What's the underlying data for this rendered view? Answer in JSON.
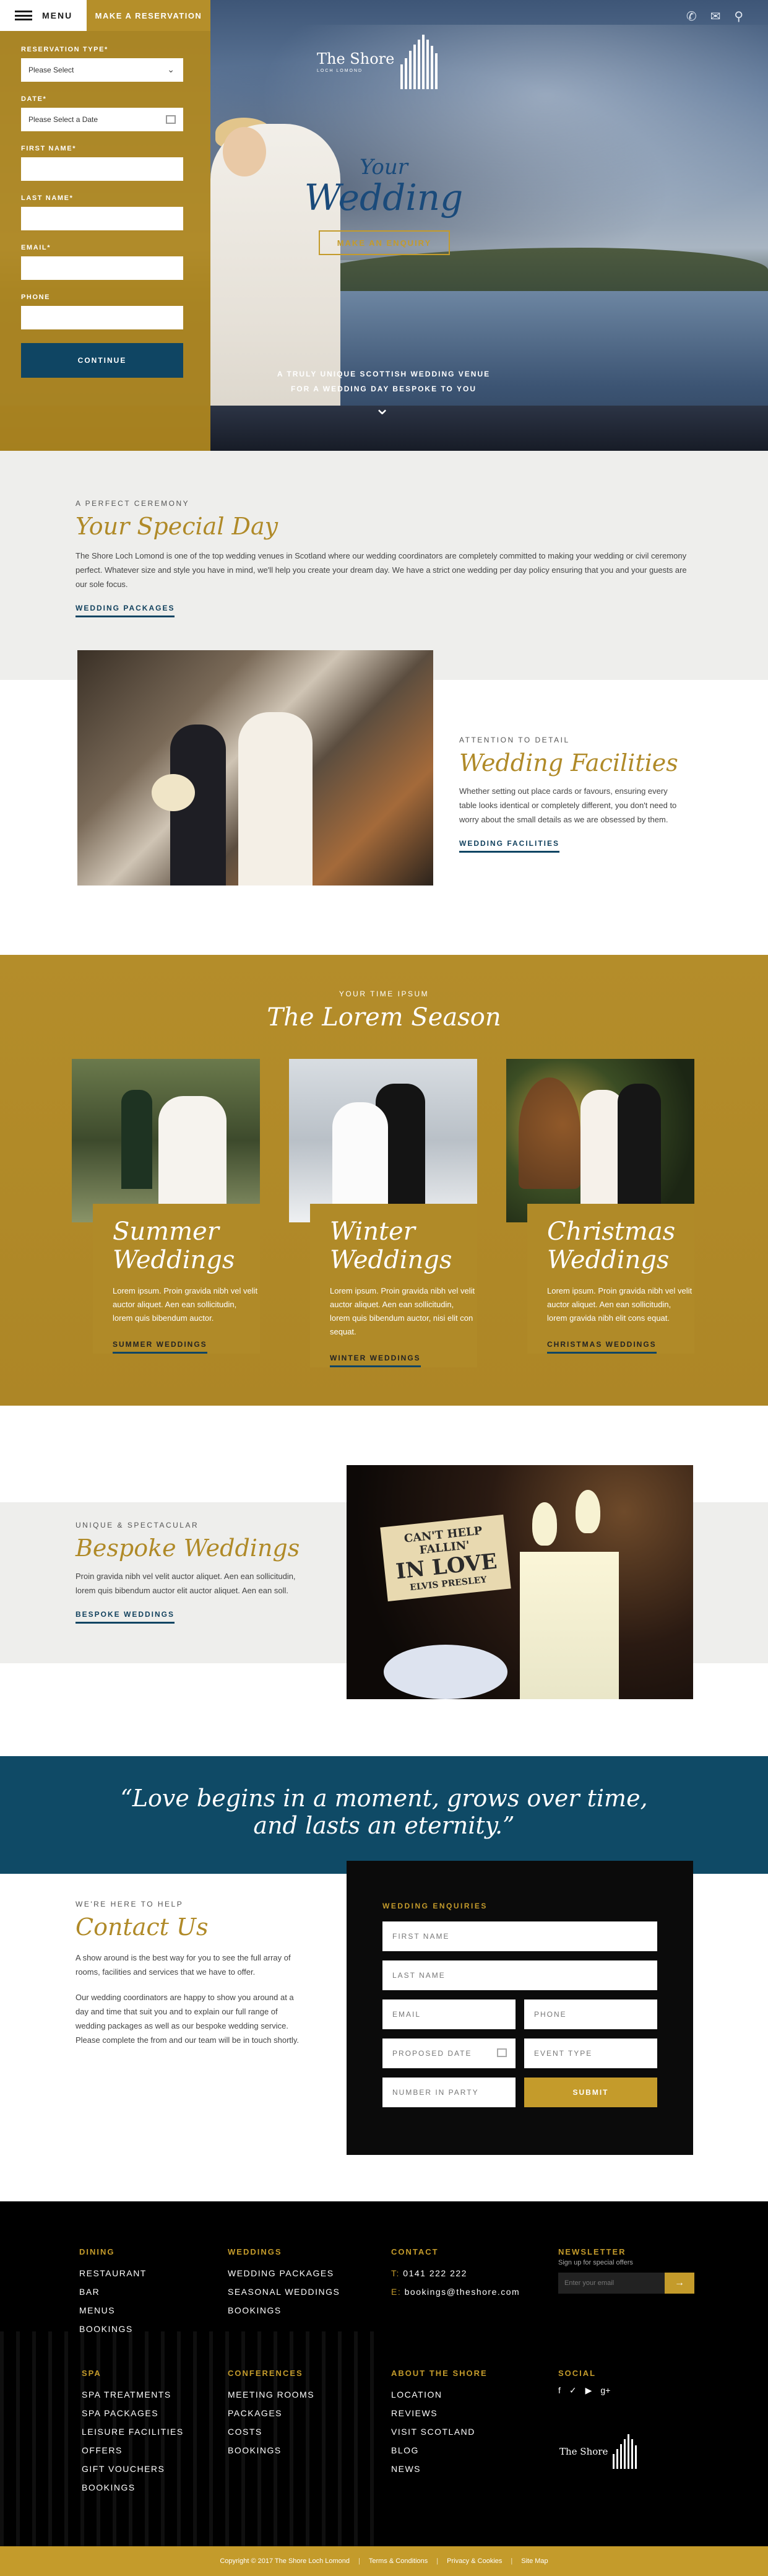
{
  "topbar": {
    "menu_label": "MENU",
    "reservation_label": "MAKE A RESERVATION"
  },
  "reservation_form": {
    "type_label": "RESERVATION TYPE*",
    "type_value": "Please Select",
    "date_label": "DATE*",
    "date_value": "Please Select a Date",
    "first_name_label": "FIRST NAME*",
    "last_name_label": "LAST NAME*",
    "email_label": "EMAIL*",
    "phone_label": "PHONE",
    "continue_label": "CONTINUE"
  },
  "hero": {
    "logo_name": "The Shore",
    "logo_sub": "LOCH LOMOND",
    "title_small": "Your",
    "title_big": "Wedding",
    "enquiry_button": "MAKE AN ENQUIRY",
    "tagline_line1": "A TRULY UNIQUE SCOTTISH WEDDING VENUE",
    "tagline_line2": "FOR A WEDDING DAY BESPOKE TO YOU"
  },
  "ceremony": {
    "eyebrow": "A PERFECT CEREMONY",
    "heading": "Your Special Day",
    "body": "The Shore Loch Lomond is one of the top wedding venues in Scotland where our wedding coordinators are completely committed to making your wedding or civil ceremony perfect. Whatever size and style you have in mind, we'll help you create your dream day. We have a strict one wedding per day policy ensuring that you and your guests are our sole focus.",
    "link": "WEDDING PACKAGES"
  },
  "facilities": {
    "eyebrow": "ATTENTION TO DETAIL",
    "heading": "Wedding Facilities",
    "body": "Whether setting out place cards or favours, ensuring every table looks identical or completely different, you don't need to worry about the small details as we are obsessed by them.",
    "link": "WEDDING FACILITIES"
  },
  "season": {
    "eyebrow": "YOUR TIME IPSUM",
    "heading": "The Lorem Season",
    "cards": [
      {
        "title1": "Summer",
        "title2": "Weddings",
        "text": "Lorem ipsum. Proin gravida nibh vel velit auctor aliquet. Aen ean sollicitudin, lorem quis bibendum auctor.",
        "link": "SUMMER WEDDINGS"
      },
      {
        "title1": "Winter",
        "title2": "Weddings",
        "text": "Lorem ipsum. Proin gravida nibh vel velit auctor aliquet. Aen ean sollicitudin, lorem quis bibendum auctor, nisi elit con sequat.",
        "link": "WINTER WEDDINGS"
      },
      {
        "title1": "Christmas",
        "title2": "Weddings",
        "text": "Lorem ipsum. Proin gravida nibh vel velit auctor aliquet. Aen ean sollicitudin, lorem gravida nibh elit cons equat.",
        "link": "CHRISTMAS WEDDINGS"
      }
    ]
  },
  "bespoke": {
    "eyebrow": "UNIQUE & SPECTACULAR",
    "heading": "Bespoke Weddings",
    "body": "Proin gravida nibh vel velit auctor aliquet. Aen ean sollicitudin, lorem quis bibendum auctor elit auctor aliquet. Aen ean soll.",
    "link": "BESPOKE WEDDINGS",
    "sign_line1": "CAN'T HELP FALLIN'",
    "sign_line2": "IN LOVE",
    "sign_line3": "ELVIS PRESLEY"
  },
  "quote": {
    "line1": "“Love begins in a moment, grows over time,",
    "line2": "and lasts an eternity.”"
  },
  "contact": {
    "eyebrow": "WE'RE HERE TO HELP",
    "heading": "Contact Us",
    "para1": "A show around is the best way for you to see the full array of rooms, facilities and services that we have to offer.",
    "para2": "Our wedding coordinators are happy to show you around at a day and time that suit you and to explain our full range of wedding packages as well as our bespoke wedding service. Please complete the from and our team will be in touch shortly."
  },
  "enquiry_form": {
    "title": "WEDDING ENQUIRIES",
    "first_name": "FIRST NAME",
    "last_name": "LAST NAME",
    "email": "EMAIL",
    "phone": "PHONE",
    "proposed_date": "PROPOSED DATE",
    "event_type": "EVENT TYPE",
    "number_in_party": "NUMBER IN PARTY",
    "submit": "SUBMIT"
  },
  "footer": {
    "dining": {
      "heading": "DINING",
      "items": [
        "RESTAURANT",
        "BAR",
        "MENUS",
        "BOOKINGS"
      ]
    },
    "weddings": {
      "heading": "WEDDINGS",
      "items": [
        "WEDDING PACKAGES",
        "SEASONAL WEDDINGS",
        "BOOKINGS"
      ]
    },
    "contact": {
      "heading": "CONTACT",
      "phone_prefix": "T:",
      "phone": "0141 222 222",
      "email_prefix": "E:",
      "email": "bookings@theshore.com"
    },
    "newsletter": {
      "heading": "NEWSLETTER",
      "sub": "Sign up for special offers",
      "placeholder": "Enter your email",
      "button": "→"
    },
    "spa": {
      "heading": "SPA",
      "items": [
        "SPA TREATMENTS",
        "SPA PACKAGES",
        "LEISURE FACILITIES",
        "OFFERS",
        "GIFT VOUCHERS",
        "BOOKINGS"
      ]
    },
    "conferences": {
      "heading": "CONFERENCES",
      "items": [
        "MEETING ROOMS",
        "PACKAGES",
        "COSTS",
        "BOOKINGS"
      ]
    },
    "about": {
      "heading": "ABOUT THE SHORE",
      "items": [
        "LOCATION",
        "REVIEWS",
        "VISIT SCOTLAND",
        "BLOG",
        "NEWS"
      ]
    },
    "social": {
      "heading": "SOCIAL"
    },
    "logo_name": "The Shore"
  },
  "copyright": {
    "text": "Copyright © 2017 The Shore Loch Lomond",
    "terms": "Terms & Conditions",
    "privacy": "Privacy & Cookies",
    "sitemap": "Site Map"
  },
  "colors": {
    "gold": "#b08a28",
    "navy": "#0f4563",
    "black": "#000000"
  }
}
